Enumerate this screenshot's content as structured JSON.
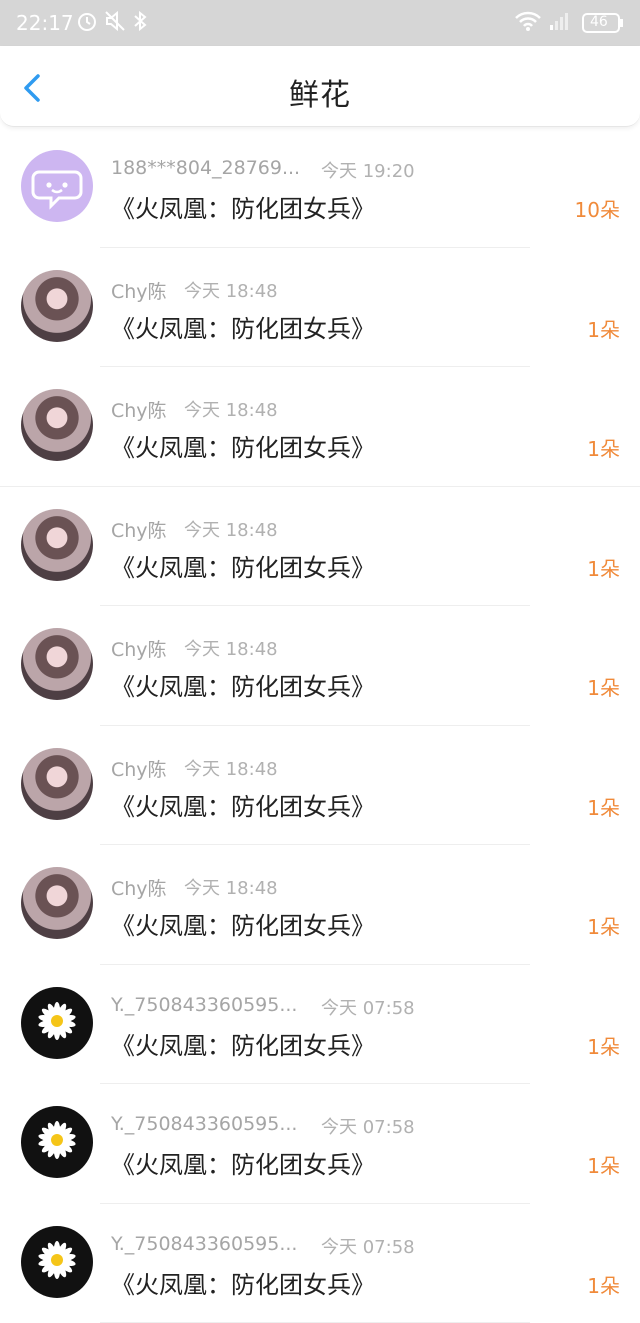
{
  "status_bar": {
    "time": "22:17",
    "battery": "46"
  },
  "header": {
    "title": "鲜花"
  },
  "items": [
    {
      "name": "188***804_28769...",
      "time": "今天 19:20",
      "book": "《火凤凰：防化团女兵》",
      "count": "10朵",
      "avatar": "chat-bubble-avatar"
    },
    {
      "name": "Chy陈",
      "time": "今天 18:48",
      "book": "《火凤凰：防化团女兵》",
      "count": "1朵",
      "avatar": "girl-avatar"
    },
    {
      "name": "Chy陈",
      "time": "今天 18:48",
      "book": "《火凤凰：防化团女兵》",
      "count": "1朵",
      "avatar": "girl-avatar"
    },
    {
      "name": "Chy陈",
      "time": "今天 18:48",
      "book": "《火凤凰：防化团女兵》",
      "count": "1朵",
      "avatar": "girl-avatar"
    },
    {
      "name": "Chy陈",
      "time": "今天 18:48",
      "book": "《火凤凰：防化团女兵》",
      "count": "1朵",
      "avatar": "girl-avatar"
    },
    {
      "name": "Chy陈",
      "time": "今天 18:48",
      "book": "《火凤凰：防化团女兵》",
      "count": "1朵",
      "avatar": "girl-avatar"
    },
    {
      "name": "Chy陈",
      "time": "今天 18:48",
      "book": "《火凤凰：防化团女兵》",
      "count": "1朵",
      "avatar": "girl-avatar"
    },
    {
      "name": "Y._750843360595...",
      "time": "今天 07:58",
      "book": "《火凤凰：防化团女兵》",
      "count": "1朵",
      "avatar": "daisy-avatar"
    },
    {
      "name": "Y._750843360595...",
      "time": "今天 07:58",
      "book": "《火凤凰：防化团女兵》",
      "count": "1朵",
      "avatar": "daisy-avatar"
    },
    {
      "name": "Y._750843360595...",
      "time": "今天 07:58",
      "book": "《火凤凰：防化团女兵》",
      "count": "1朵",
      "avatar": "daisy-avatar"
    }
  ],
  "colors": {
    "accent_blue": "#2f9bf0",
    "count_orange": "#f08a3a",
    "status_bar": "#d6d6d6"
  }
}
